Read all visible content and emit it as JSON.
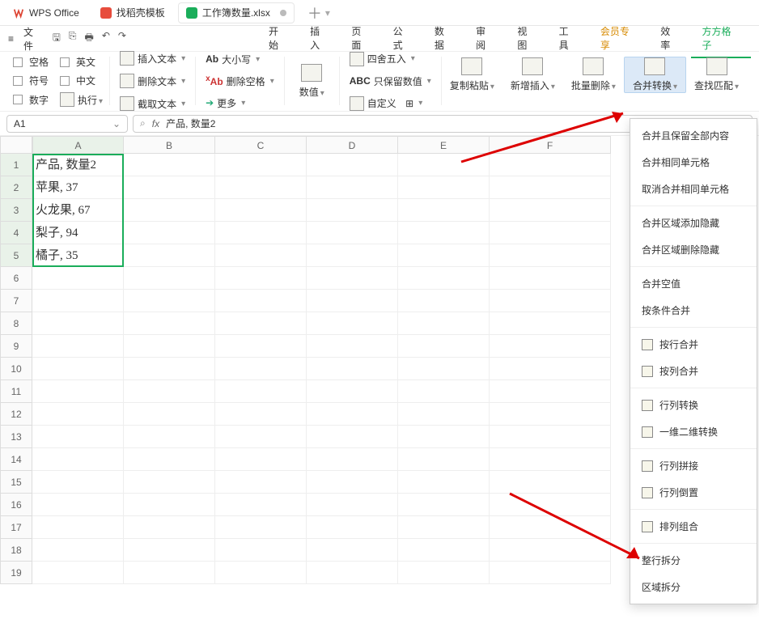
{
  "title_tabs": {
    "wps": "WPS Office",
    "db": "找稻壳模板",
    "file": "工作簿数量.xlsx"
  },
  "qat": {
    "file_label": "文件"
  },
  "ribbon_tabs": {
    "start": "开始",
    "insert": "插入",
    "page": "页面",
    "formula": "公式",
    "data": "数据",
    "review": "审阅",
    "view": "视图",
    "tool": "工具",
    "member": "会员专享",
    "eff": "效率",
    "ffgz": "方方格子"
  },
  "ribbon": {
    "space": "空格",
    "english": "英文",
    "symbol": "符号",
    "chinese": "中文",
    "number": "数字",
    "run": "执行",
    "insText": "插入文本",
    "delText": "删除文本",
    "cutText": "截取文本",
    "case": "大小写",
    "delBlank": "删除空格",
    "more": "更多",
    "numeric": "数值",
    "round": "四舍五入",
    "keepNum": "只保留数值",
    "custom": "自定义",
    "copy": "复制粘贴",
    "newIns": "新增插入",
    "bulkDel": "批量删除",
    "merge": "合并转换",
    "find": "查找匹配"
  },
  "formula_bar": {
    "name": "A1",
    "fx": "fx",
    "value": "产品, 数量2"
  },
  "columns": [
    "A",
    "B",
    "C",
    "D",
    "E",
    "F"
  ],
  "cells": {
    "A1": "产品, 数量2",
    "A2": "苹果, 37",
    "A3": "火龙果, 67",
    "A4": "梨子, 94",
    "A5": "橘子, 35"
  },
  "menu": {
    "m1": "合并且保留全部内容",
    "m2": "合并相同单元格",
    "m3": "取消合并相同单元格",
    "m4": "合并区域添加隐藏",
    "m5": "合并区域删除隐藏",
    "m6": "合并空值",
    "m7": "按条件合并",
    "m8": "按行合并",
    "m9": "按列合并",
    "m10": "行列转换",
    "m11": "一维二维转换",
    "m12": "行列拼接",
    "m13": "行列倒置",
    "m14": "排列组合",
    "m15": "整行拆分",
    "m16": "区域拆分"
  }
}
